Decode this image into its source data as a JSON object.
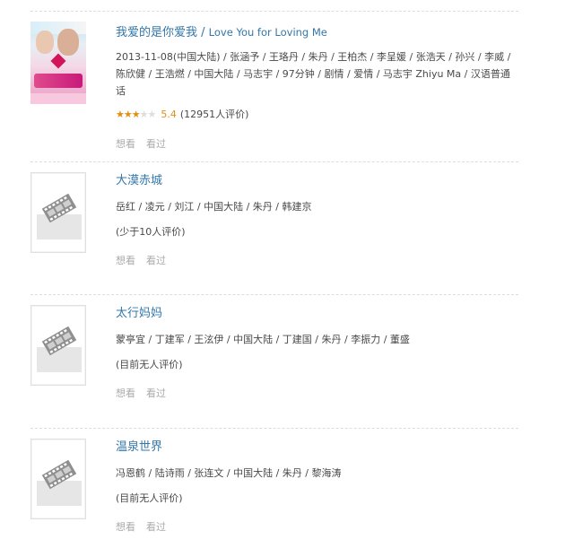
{
  "items": [
    {
      "title_cn": "我爱的是你爱我",
      "title_sep": " / ",
      "title_en": "Love You for Loving Me",
      "meta": "2013-11-08(中国大陆) / 张涵予 / 王珞丹 / 朱丹 / 王柏杰 / 李呈媛 / 张浩天 / 孙兴 / 李威 / 陈欣健 / 王浩燃 / 中国大陆 / 马志宇 / 97分钟 / 剧情 / 爱情 / 马志宇 Zhiyu Ma / 汉语普通话",
      "stars_on": "★★★",
      "stars_off": "★★",
      "score": "5.4",
      "rating_text": "(12951人评价)",
      "poster": "movie-poster-image",
      "actions": {
        "want": "想看",
        "seen": "看过"
      }
    },
    {
      "title_cn": "大漠赤城",
      "meta": "岳红 / 凌元 / 刘江 / 中国大陆 / 朱丹 / 韩建京",
      "rating_text": "(少于10人评价)",
      "poster": "film-reel-placeholder-icon",
      "actions": {
        "want": "想看",
        "seen": "看过"
      }
    },
    {
      "title_cn": "太行妈妈",
      "meta": "蒙亭宜 / 丁建军 / 王泫伊 / 中国大陆 / 丁建国 / 朱丹 / 李振力 / 董盛",
      "rating_text": "(目前无人评价)",
      "poster": "film-reel-placeholder-icon",
      "actions": {
        "want": "想看",
        "seen": "看过"
      }
    },
    {
      "title_cn": "温泉世界",
      "meta": "冯恩鹤 / 陆诗雨 / 张连文 / 中国大陆 / 朱丹 / 黎海涛",
      "rating_text": "(目前无人评价)",
      "poster": "film-reel-placeholder-icon",
      "actions": {
        "want": "想看",
        "seen": "看过"
      }
    }
  ],
  "colors": {
    "link": "#3377aa",
    "star": "#e09015",
    "muted": "#aaaaaa",
    "divider": "#dddddd"
  }
}
